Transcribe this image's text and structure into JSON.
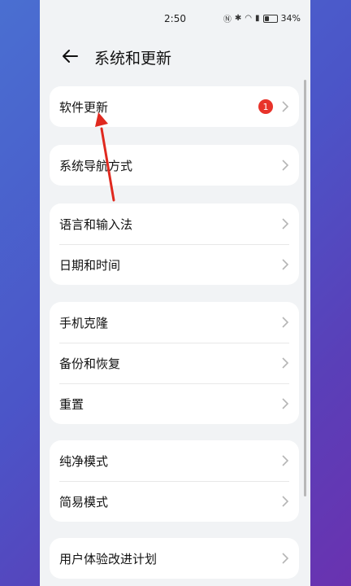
{
  "status": {
    "time": "2:50",
    "battery_percent_text": "34%",
    "battery_level": 0.34,
    "icons": [
      "nfc-icon",
      "bluetooth-icon",
      "wifi-icon",
      "sim-icon",
      "battery-icon"
    ]
  },
  "header": {
    "back_icon": "back-arrow-icon",
    "title": "系统和更新"
  },
  "groups": [
    {
      "items": [
        {
          "label": "软件更新",
          "badge": "1"
        }
      ]
    },
    {
      "items": [
        {
          "label": "系统导航方式"
        }
      ]
    },
    {
      "items": [
        {
          "label": "语言和输入法"
        },
        {
          "label": "日期和时间"
        }
      ]
    },
    {
      "items": [
        {
          "label": "手机克隆"
        },
        {
          "label": "备份和恢复"
        },
        {
          "label": "重置"
        }
      ]
    },
    {
      "items": [
        {
          "label": "纯净模式"
        },
        {
          "label": "简易模式"
        }
      ]
    },
    {
      "items": [
        {
          "label": "用户体验改进计划"
        }
      ]
    }
  ],
  "colors": {
    "badge": "#e8332a",
    "annotation_arrow": "#e0291f",
    "panel_bg": "#f1f3f5"
  }
}
